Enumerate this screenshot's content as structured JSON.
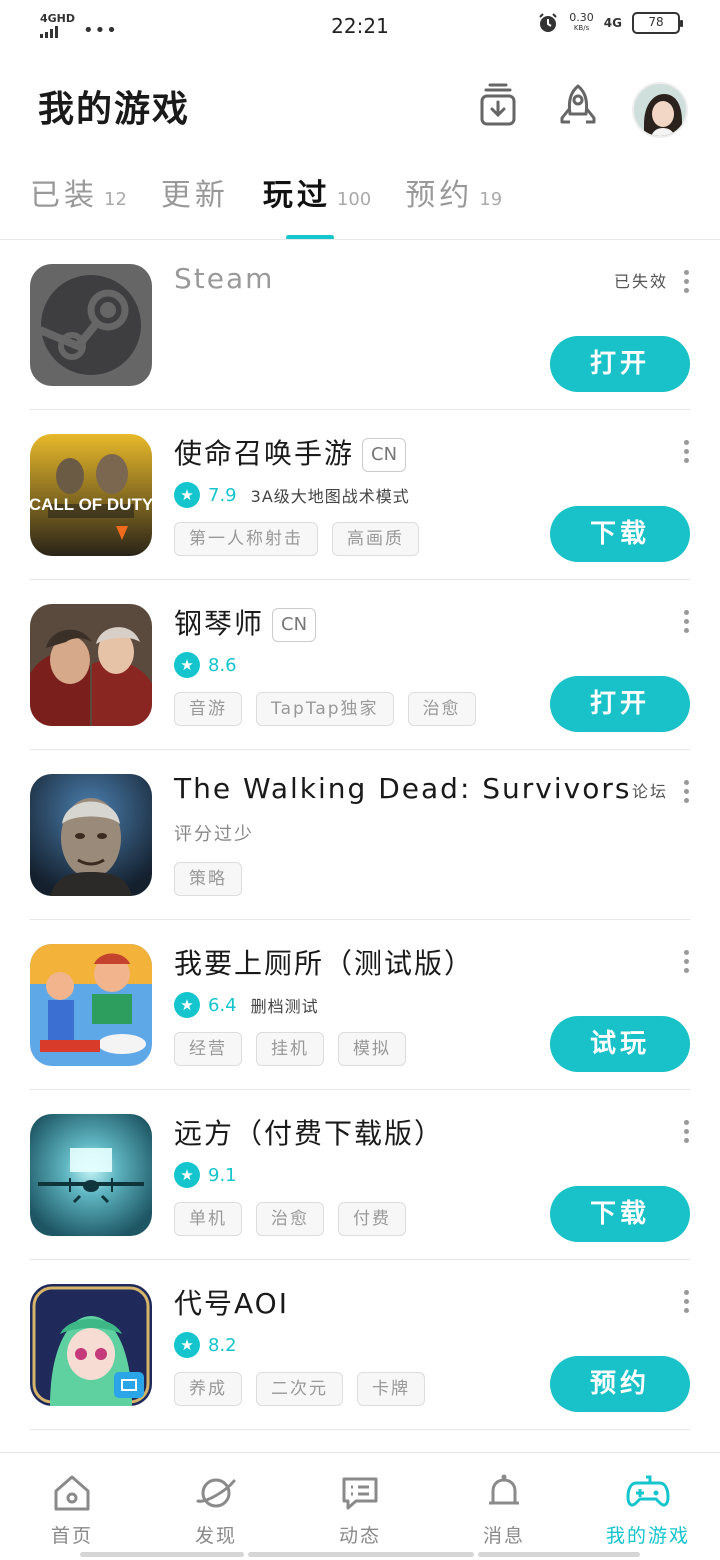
{
  "status_bar": {
    "network": "4GHD",
    "time": "22:21",
    "speed": "0.30",
    "speed_unit": "KB/s",
    "network_right": "4G",
    "battery": "78"
  },
  "header": {
    "title": "我的游戏",
    "icons": [
      "download-manager-icon",
      "rocket-icon"
    ],
    "avatar": "user-avatar"
  },
  "tabs": [
    {
      "label": "已装",
      "count": "12"
    },
    {
      "label": "更新",
      "count": ""
    },
    {
      "label": "玩过",
      "count": "100"
    },
    {
      "label": "预约",
      "count": "19"
    }
  ],
  "active_tab": "玩过",
  "games": [
    {
      "title": "Steam",
      "status": "已失效",
      "action": "打开"
    },
    {
      "title": "使命召唤手游",
      "region": "CN",
      "score": "7.9",
      "subtitle": "3A级大地图战术模式",
      "tags": [
        "第一人称射击",
        "高画质"
      ],
      "action": "下载"
    },
    {
      "title": "钢琴师",
      "region": "CN",
      "score": "8.6",
      "tags": [
        "音游",
        "TapTap独家",
        "治愈"
      ],
      "action": "打开"
    },
    {
      "title": "The Walking Dead: Survivors",
      "status": "论坛",
      "rating_note": "评分过少",
      "tags": [
        "策略"
      ]
    },
    {
      "title": "我要上厕所（测试版）",
      "score": "6.4",
      "subtitle": "删档测试",
      "tags": [
        "经营",
        "挂机",
        "模拟"
      ],
      "action": "试玩"
    },
    {
      "title": "远方（付费下载版）",
      "score": "9.1",
      "tags": [
        "单机",
        "治愈",
        "付费"
      ],
      "action": "下载"
    },
    {
      "title": "代号AOI",
      "score": "8.2",
      "tags": [
        "养成",
        "二次元",
        "卡牌"
      ],
      "action": "预约"
    }
  ],
  "bottom_nav": [
    {
      "label": "首页",
      "icon": "home-icon"
    },
    {
      "label": "发现",
      "icon": "planet-icon"
    },
    {
      "label": "动态",
      "icon": "chat-icon"
    },
    {
      "label": "消息",
      "icon": "bell-icon"
    },
    {
      "label": "我的游戏",
      "icon": "gamepad-icon"
    }
  ],
  "colors": {
    "accent": "#15c5ce"
  }
}
